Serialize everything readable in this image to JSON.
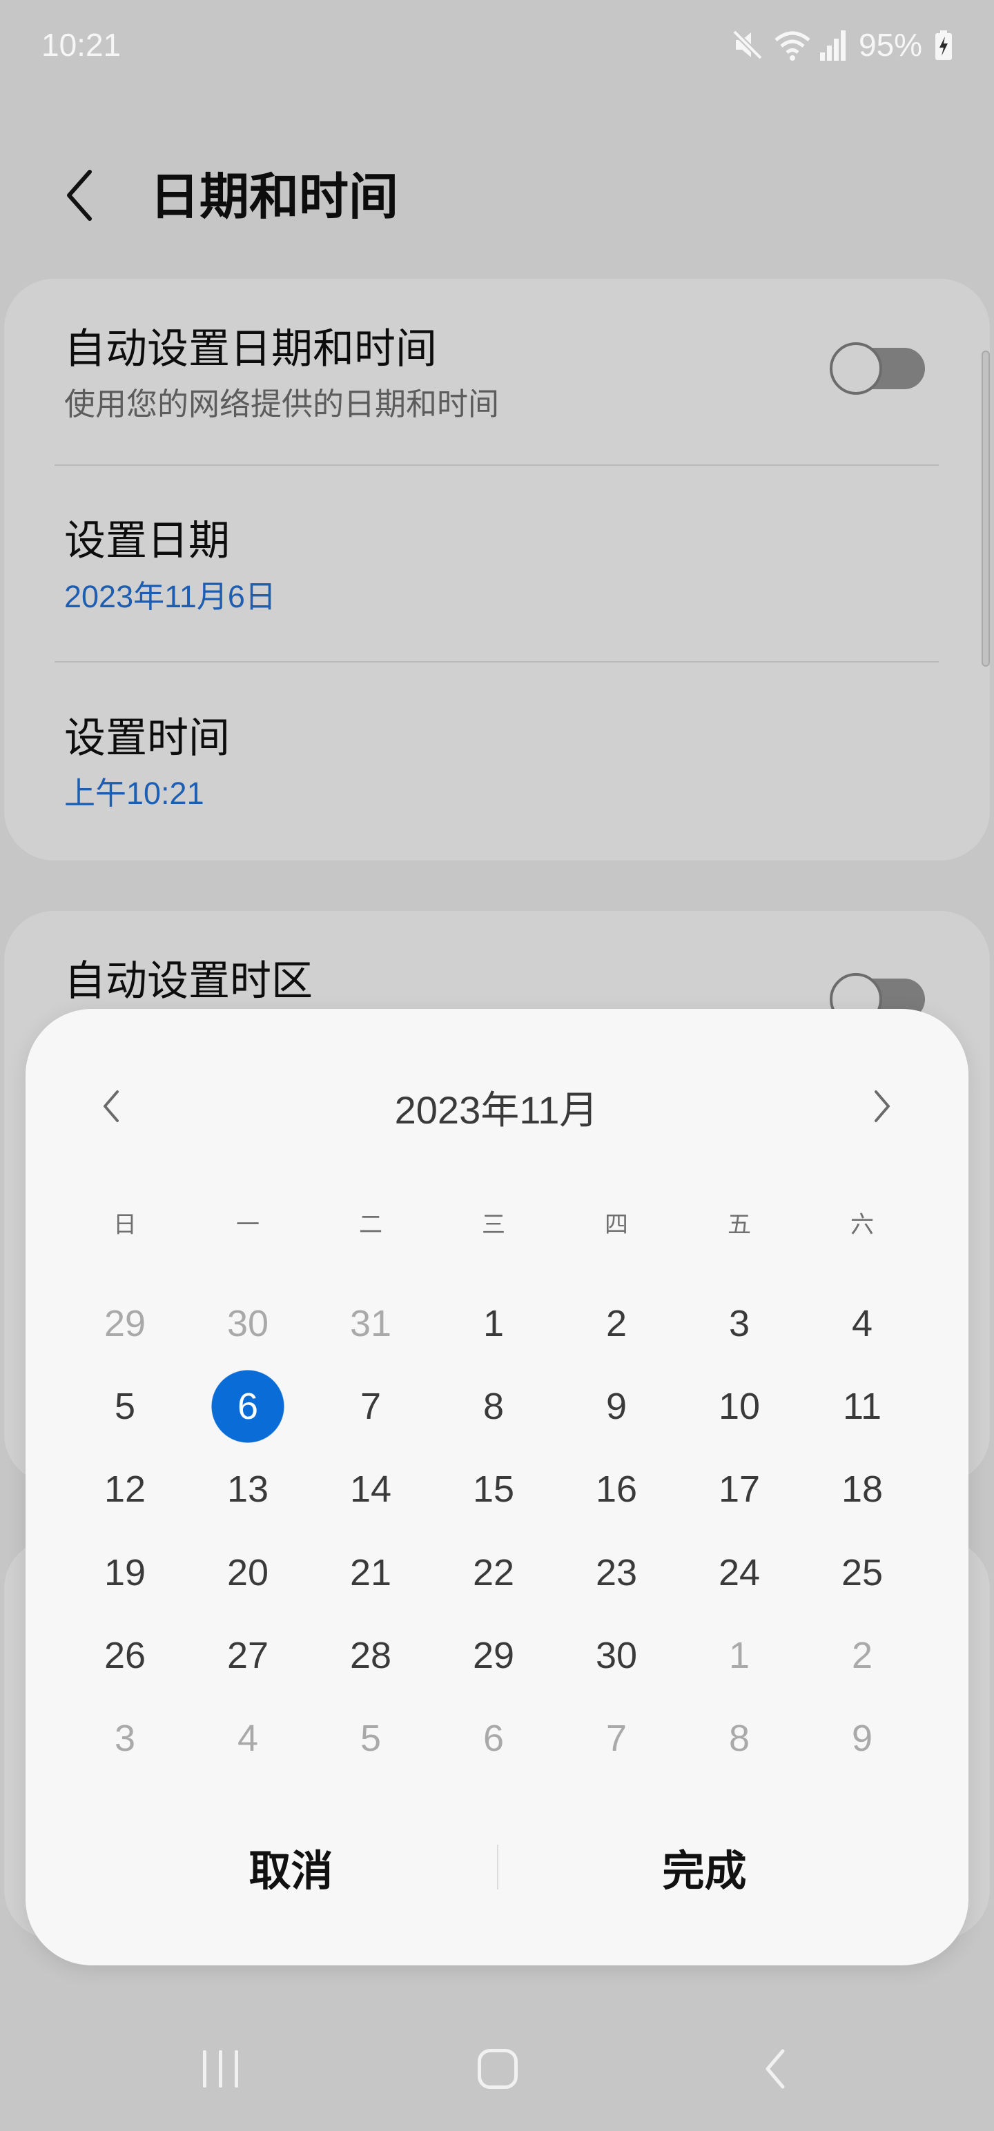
{
  "status_bar": {
    "time": "10:21",
    "battery_percent": "95%",
    "icons": [
      "mute-icon",
      "wifi-icon",
      "signal-icon",
      "battery-charging-icon"
    ]
  },
  "header": {
    "title": "日期和时间",
    "back_icon": "back-chevron-icon"
  },
  "settings": {
    "auto_datetime": {
      "title": "自动设置日期和时间",
      "subtitle": "使用您的网络提供的日期和时间",
      "enabled": false
    },
    "set_date": {
      "title": "设置日期",
      "value": "2023年11月6日"
    },
    "set_time": {
      "title": "设置时间",
      "value": "上午10:21"
    },
    "auto_timezone": {
      "title": "自动设置时区",
      "enabled": false
    }
  },
  "date_picker": {
    "month_label": "2023年11月",
    "prev_icon": "chevron-left-icon",
    "next_icon": "chevron-right-icon",
    "weekdays": [
      "日",
      "一",
      "二",
      "三",
      "四",
      "五",
      "六"
    ],
    "selected_day": "6",
    "weeks": [
      [
        {
          "day": "29",
          "in_month": false
        },
        {
          "day": "30",
          "in_month": false
        },
        {
          "day": "31",
          "in_month": false
        },
        {
          "day": "1",
          "in_month": true
        },
        {
          "day": "2",
          "in_month": true
        },
        {
          "day": "3",
          "in_month": true
        },
        {
          "day": "4",
          "in_month": true
        }
      ],
      [
        {
          "day": "5",
          "in_month": true
        },
        {
          "day": "6",
          "in_month": true
        },
        {
          "day": "7",
          "in_month": true
        },
        {
          "day": "8",
          "in_month": true
        },
        {
          "day": "9",
          "in_month": true
        },
        {
          "day": "10",
          "in_month": true
        },
        {
          "day": "11",
          "in_month": true
        }
      ],
      [
        {
          "day": "12",
          "in_month": true
        },
        {
          "day": "13",
          "in_month": true
        },
        {
          "day": "14",
          "in_month": true
        },
        {
          "day": "15",
          "in_month": true
        },
        {
          "day": "16",
          "in_month": true
        },
        {
          "day": "17",
          "in_month": true
        },
        {
          "day": "18",
          "in_month": true
        }
      ],
      [
        {
          "day": "19",
          "in_month": true
        },
        {
          "day": "20",
          "in_month": true
        },
        {
          "day": "21",
          "in_month": true
        },
        {
          "day": "22",
          "in_month": true
        },
        {
          "day": "23",
          "in_month": true
        },
        {
          "day": "24",
          "in_month": true
        },
        {
          "day": "25",
          "in_month": true
        }
      ],
      [
        {
          "day": "26",
          "in_month": true
        },
        {
          "day": "27",
          "in_month": true
        },
        {
          "day": "28",
          "in_month": true
        },
        {
          "day": "29",
          "in_month": true
        },
        {
          "day": "30",
          "in_month": true
        },
        {
          "day": "1",
          "in_month": false
        },
        {
          "day": "2",
          "in_month": false
        }
      ],
      [
        {
          "day": "3",
          "in_month": false
        },
        {
          "day": "4",
          "in_month": false
        },
        {
          "day": "5",
          "in_month": false
        },
        {
          "day": "6",
          "in_month": false
        },
        {
          "day": "7",
          "in_month": false
        },
        {
          "day": "8",
          "in_month": false
        },
        {
          "day": "9",
          "in_month": false
        }
      ]
    ],
    "cancel_label": "取消",
    "done_label": "完成"
  },
  "nav_bar": {
    "icons": [
      "recent-apps-icon",
      "home-icon",
      "back-icon"
    ]
  },
  "colors": {
    "page_bg": "#c6c6c6",
    "card_bg": "#d0d0d0",
    "text": "#0d0d0d",
    "text_secondary": "#5c5c5c",
    "link": "#1d5eb3",
    "divider": "#b9b9b9",
    "dialog_bg": "#f7f7f7",
    "date_text": "#3a3a3a",
    "date_out": "#a9a9a9",
    "weekday": "#707070",
    "accent": "#0a6cd7",
    "button_text": "#111111",
    "status_fg": "#f6f6f6",
    "nav_fg": "#f1f1f1"
  }
}
